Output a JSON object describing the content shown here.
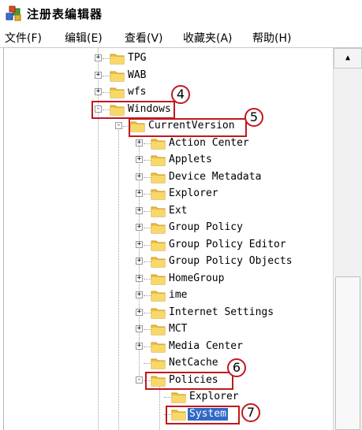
{
  "window": {
    "title": "注册表编辑器",
    "icon": "registry-editor-icon"
  },
  "menu": [
    "文件(F)",
    "编辑(E)",
    "查看(V)",
    "收藏夹(A)",
    "帮助(H)"
  ],
  "tree": {
    "nodes": [
      {
        "label": "TPG",
        "expander": "+",
        "level": 0
      },
      {
        "label": "WAB",
        "expander": "+",
        "level": 0
      },
      {
        "label": "wfs",
        "expander": "+",
        "level": 0
      },
      {
        "label": "Windows",
        "expander": "-",
        "level": 0
      },
      {
        "label": "CurrentVersion",
        "expander": "-",
        "level": 1
      },
      {
        "label": "Action Center",
        "expander": "+",
        "level": 2
      },
      {
        "label": "Applets",
        "expander": "+",
        "level": 2
      },
      {
        "label": "Device Metadata",
        "expander": "+",
        "level": 2
      },
      {
        "label": "Explorer",
        "expander": "+",
        "level": 2
      },
      {
        "label": "Ext",
        "expander": "+",
        "level": 2
      },
      {
        "label": "Group Policy",
        "expander": "+",
        "level": 2
      },
      {
        "label": "Group Policy Editor",
        "expander": "+",
        "level": 2
      },
      {
        "label": "Group Policy Objects",
        "expander": "+",
        "level": 2
      },
      {
        "label": "HomeGroup",
        "expander": "+",
        "level": 2
      },
      {
        "label": "ime",
        "expander": "+",
        "level": 2
      },
      {
        "label": "Internet Settings",
        "expander": "+",
        "level": 2
      },
      {
        "label": "MCT",
        "expander": "+",
        "level": 2
      },
      {
        "label": "Media Center",
        "expander": "+",
        "level": 2
      },
      {
        "label": "NetCache",
        "expander": "",
        "level": 2
      },
      {
        "label": "Policies",
        "expander": "-",
        "level": 2
      },
      {
        "label": "Explorer",
        "expander": "",
        "level": 3
      },
      {
        "label": "System",
        "expander": "",
        "level": 3,
        "selected": true
      }
    ]
  },
  "annotations": [
    "4",
    "5",
    "6",
    "7"
  ],
  "scrollbar": {
    "up_arrow": "▲"
  },
  "colors": {
    "highlight": "#c0181e",
    "selection": "#3169c6",
    "folder": "#f5c94a"
  }
}
